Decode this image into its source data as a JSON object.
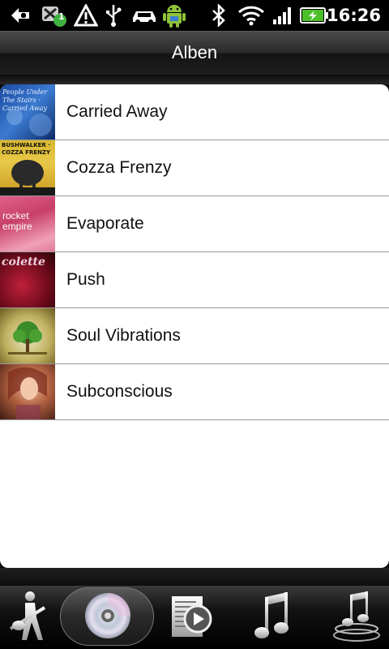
{
  "status_bar": {
    "time": "16:26",
    "notification_count": "1",
    "icons": [
      "back-arrow-icon",
      "missed-call-badge-icon",
      "warning-icon",
      "usb-icon",
      "car-icon",
      "android-icon",
      "bluetooth-icon",
      "wifi-icon",
      "signal-icon",
      "battery-charging-icon"
    ]
  },
  "header": {
    "title": "Alben"
  },
  "albums": [
    {
      "title": "Carried Away",
      "art_text": "People Under The Stairs · Carried Away"
    },
    {
      "title": "Cozza Frenzy",
      "art_text": "BUSHWALKER · COZZA FRENZY"
    },
    {
      "title": "Evaporate",
      "art_text": "rocket empire"
    },
    {
      "title": "Push",
      "art_text": "colette"
    },
    {
      "title": "Soul Vibrations",
      "art_text": ""
    },
    {
      "title": "Subconscious",
      "art_text": ""
    }
  ],
  "tabs": [
    {
      "name": "artists",
      "icon": "artist-guitar-icon",
      "active": false
    },
    {
      "name": "albums",
      "icon": "album-disc-icon",
      "active": true
    },
    {
      "name": "playlists",
      "icon": "playlist-play-icon",
      "active": false
    },
    {
      "name": "songs",
      "icon": "music-note-icon",
      "active": false
    },
    {
      "name": "genres",
      "icon": "genre-note-stack-icon",
      "active": false
    }
  ]
}
